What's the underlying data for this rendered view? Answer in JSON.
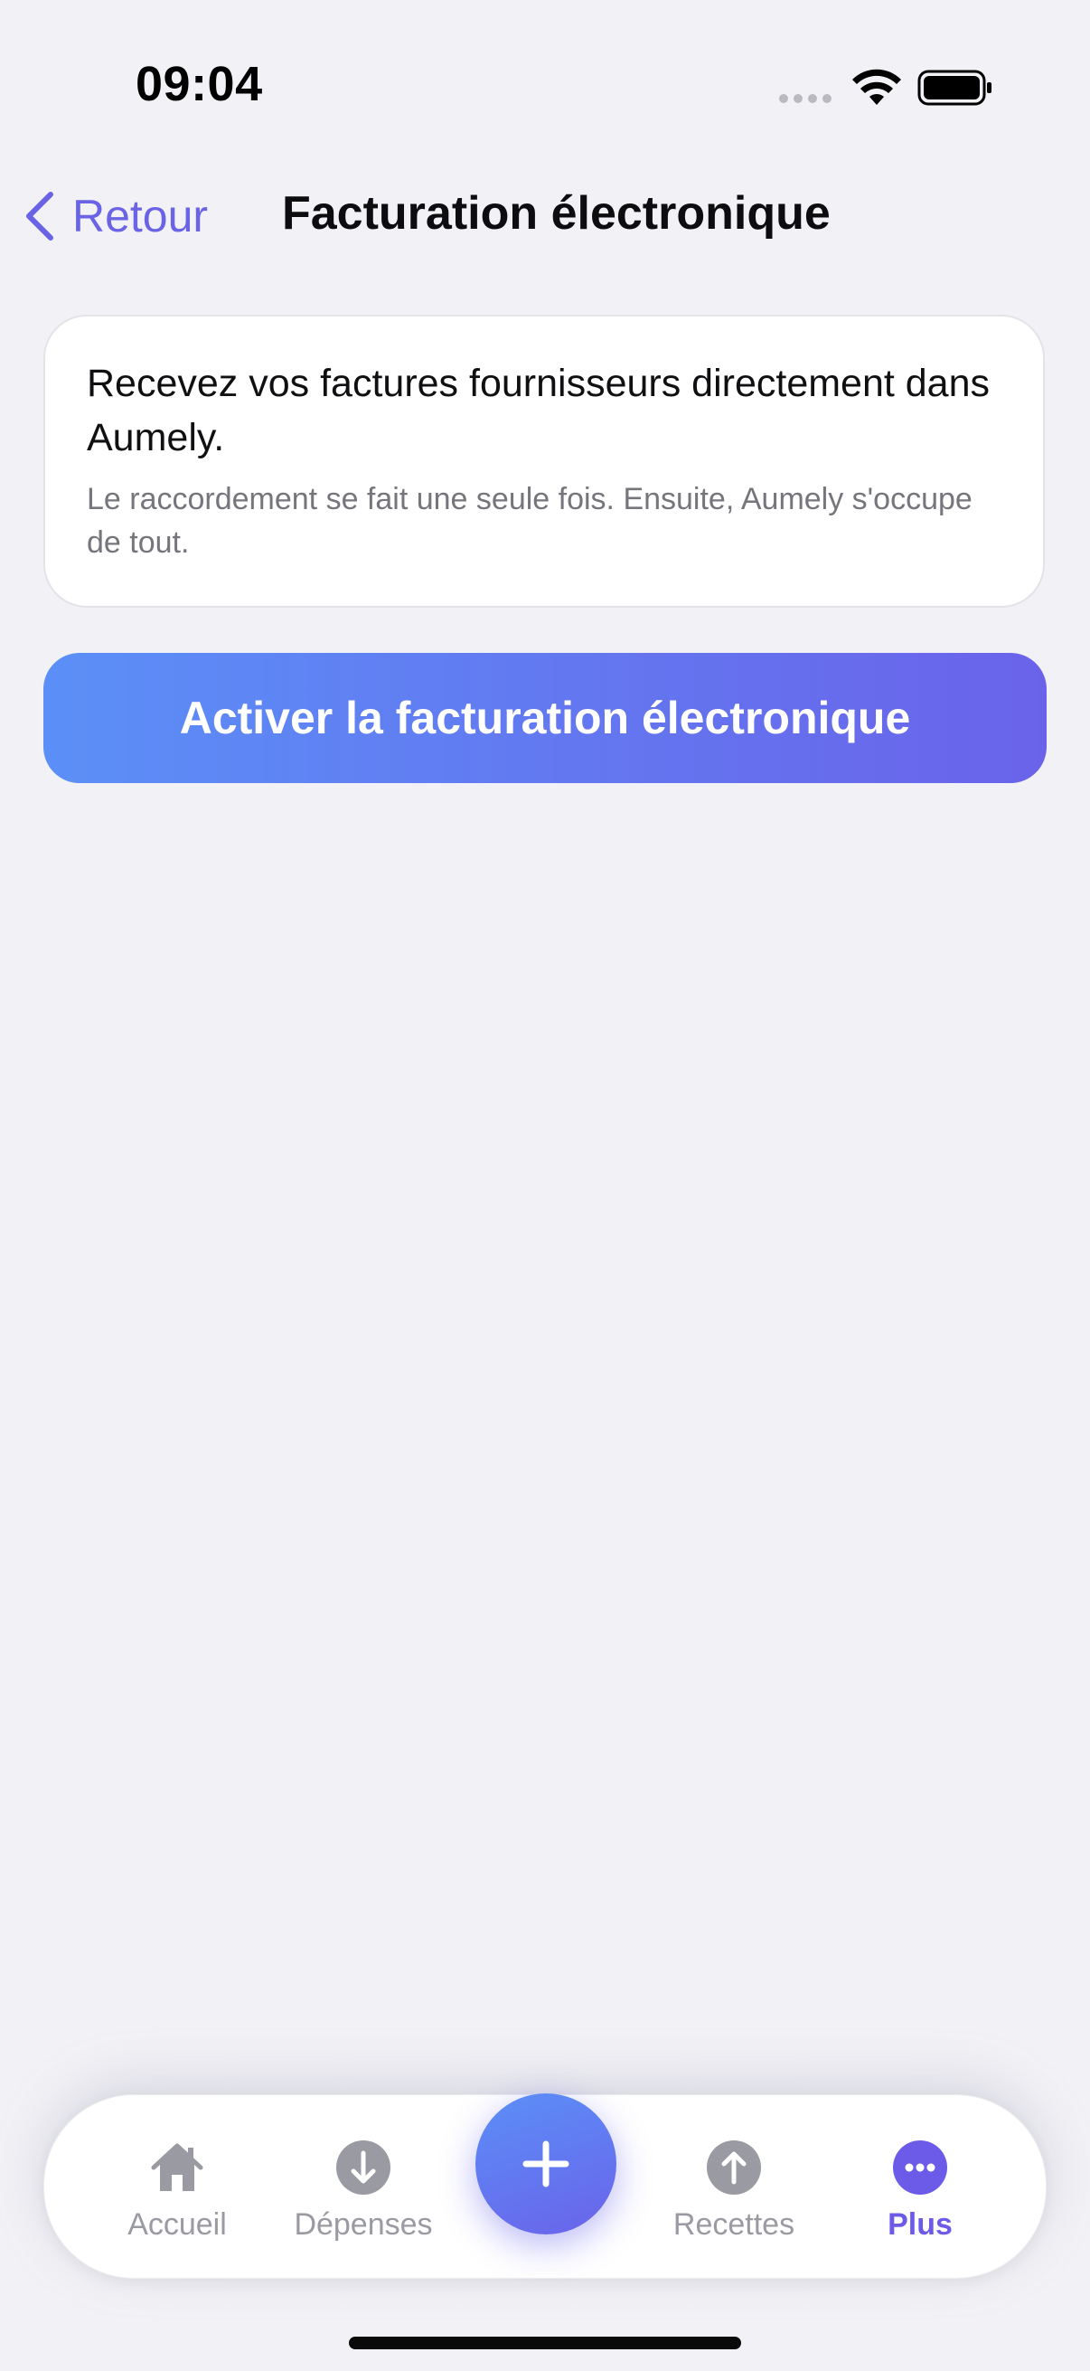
{
  "status_bar": {
    "time": "09:04"
  },
  "nav": {
    "back_label": "Retour",
    "title": "Facturation électronique"
  },
  "info_card": {
    "title": "Recevez vos factures fournisseurs directement dans Aumely.",
    "subtitle": "Le raccordement se fait une seule fois. Ensuite, Aumely s'occupe de tout."
  },
  "actions": {
    "activate_label": "Activer la facturation électronique"
  },
  "tab_bar": {
    "items": [
      {
        "label": "Accueil",
        "icon": "home-icon",
        "active": false
      },
      {
        "label": "Dépenses",
        "icon": "arrow-down-circle-icon",
        "active": false
      },
      {
        "label": "Recettes",
        "icon": "arrow-up-circle-icon",
        "active": false
      },
      {
        "label": "Plus",
        "icon": "ellipsis-circle-icon",
        "active": true
      }
    ],
    "fab_icon": "plus-icon"
  },
  "colors": {
    "accent": "#6b63e6",
    "gradient_start": "#5b8ff7",
    "gradient_end": "#6a63ea",
    "inactive_tab": "#9a9aa2",
    "background": "#f2f2f6"
  }
}
